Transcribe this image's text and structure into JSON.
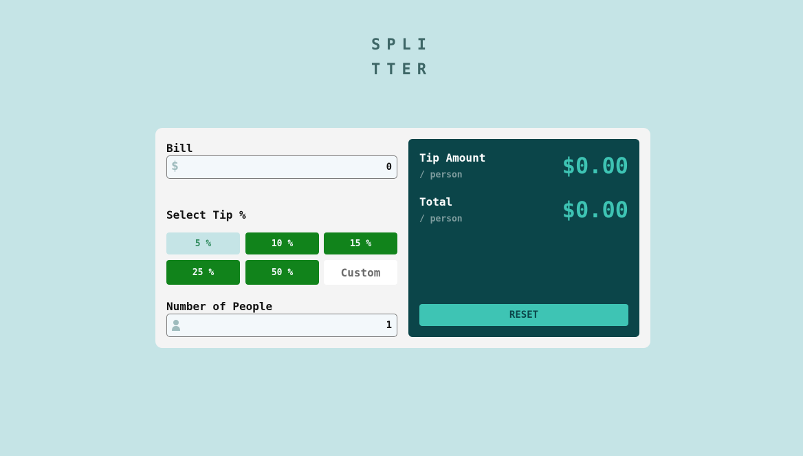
{
  "logo": {
    "line1": "SPLI",
    "line2": "TTER"
  },
  "bill": {
    "label": "Bill",
    "currency_symbol": "$",
    "value": "0"
  },
  "tip": {
    "label": "Select Tip %",
    "options": [
      "5 %",
      "10 %",
      "15 %",
      "25 %",
      "50 %"
    ],
    "active_option": "5 %",
    "custom_placeholder": "Custom"
  },
  "people": {
    "label": "Number of People",
    "value": "1",
    "icon": "person-icon"
  },
  "results": {
    "tip_amount": {
      "label": "Tip Amount",
      "sub": "/ person",
      "value": "$0.00"
    },
    "total": {
      "label": "Total",
      "sub": "/ person",
      "value": "$0.00"
    },
    "reset_label": "RESET"
  },
  "colors": {
    "background": "#c5e4e6",
    "card": "#f4f4f4",
    "dark_panel": "#0b4549",
    "accent": "#3ec4b4",
    "tip_button": "#11831b"
  }
}
